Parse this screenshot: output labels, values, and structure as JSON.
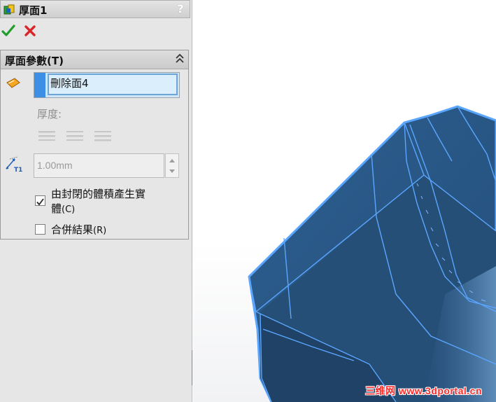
{
  "feature": {
    "title": "厚面1",
    "help_label": "?"
  },
  "group": {
    "title": "厚面參數(T)",
    "face_item": "刪除面4",
    "thickness_label": "厚度:",
    "thickness_value": "1.00mm",
    "option_close_volume": "由封閉的體積產生實體",
    "option_close_volume_hotkey": "(C)",
    "option_close_volume_line1": "由封閉的體積產生實",
    "option_close_volume_line2": "體",
    "option_close_volume_checked": true,
    "option_merge": "合併結果",
    "option_merge_hotkey": "(R)",
    "option_merge_checked": false
  },
  "icons": {
    "feature_icon": "thicken-feature-icon",
    "ok": "checkmark-icon",
    "cancel": "x-icon",
    "collapse": "double-chevron-up-icon",
    "face": "face-selection-icon",
    "thickness": "thickness-dimension-icon",
    "side1": "thicken-side1-icon",
    "side2": "thicken-both-sides-icon",
    "side3": "thicken-side2-icon"
  },
  "colors": {
    "ok": "#1f9e2a",
    "cancel": "#d8262a",
    "selection_marker": "#3d8fe5",
    "model_face": "#2a5b8b",
    "model_edge": "#5aa6ff"
  },
  "watermark": "三维网 www.3dportal.cn"
}
